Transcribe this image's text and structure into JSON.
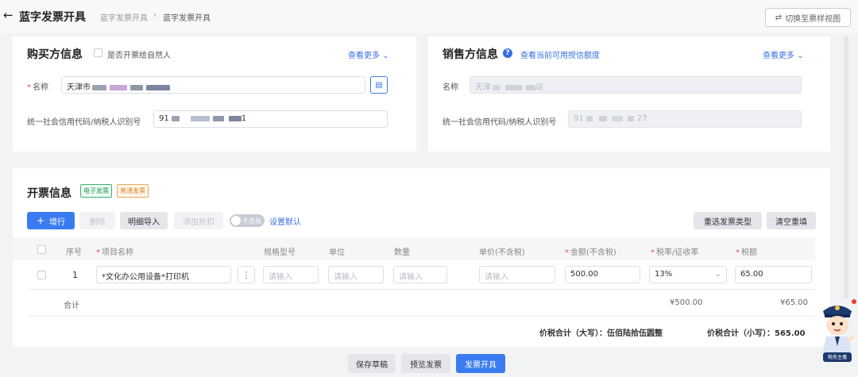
{
  "header": {
    "title": "蓝字发票开具",
    "breadcrumb": [
      "蓝字发票开具",
      "›",
      "蓝字发票开具"
    ],
    "switch_view": "切换至票样视图"
  },
  "buyer": {
    "title": "购买方信息",
    "natural_person_label": "是否开票给自然人",
    "more": "查看更多",
    "name_label": "名称",
    "name_value": "天津市",
    "tax_id_label": "统一社会信用代码/纳税人识别号",
    "tax_id_prefix": "91",
    "tax_id_suffix": "1"
  },
  "seller": {
    "title": "销售方信息",
    "credit_link": "查看当前可用授信额度",
    "more": "查看更多",
    "name_label": "名称",
    "name_value": "天津",
    "name_suffix": "站",
    "tax_id_label": "统一社会信用代码/纳税人识别号",
    "tax_id_prefix": "91",
    "tax_id_suffix": "27"
  },
  "invoice": {
    "title": "开票信息",
    "tag_electronic": "电子发票",
    "tag_normal": "普通发票",
    "toolbar": {
      "add_row": "增行",
      "delete": "删除",
      "detail_import": "明细导入",
      "add_discount": "添加折扣",
      "toggle_label": "不含税",
      "set_default": "设置默认",
      "reselect_type": "重选发票类型",
      "clear_all": "清空重填"
    },
    "columns": [
      "序号",
      "项目名称",
      "规格型号",
      "单位",
      "数量",
      "单价(不含税)",
      "金额(不含税)",
      "税率/征收率",
      "税额"
    ],
    "row": {
      "index": "1",
      "item_name": "*文化办公用设备*打印机",
      "placeholder": "请输入",
      "amount": "500.00",
      "tax_rate": "13%",
      "tax_amount": "65.00"
    },
    "sum": {
      "label": "合计",
      "amount": "¥500.00",
      "tax": "¥65.00"
    },
    "total_upper_label": "价税合计（大写）：",
    "total_upper_value": "伍佰陆拾伍圆整",
    "total_lower_label": "价税合计（小写）：",
    "total_lower_value": "565.00"
  },
  "footer": {
    "save_draft": "保存草稿",
    "preview": "预览发票",
    "issue": "发票开具"
  },
  "mascot": {
    "caption": "税务主播"
  },
  "colors": {
    "primary": "#3a7cf0",
    "required": "#e34d59"
  }
}
